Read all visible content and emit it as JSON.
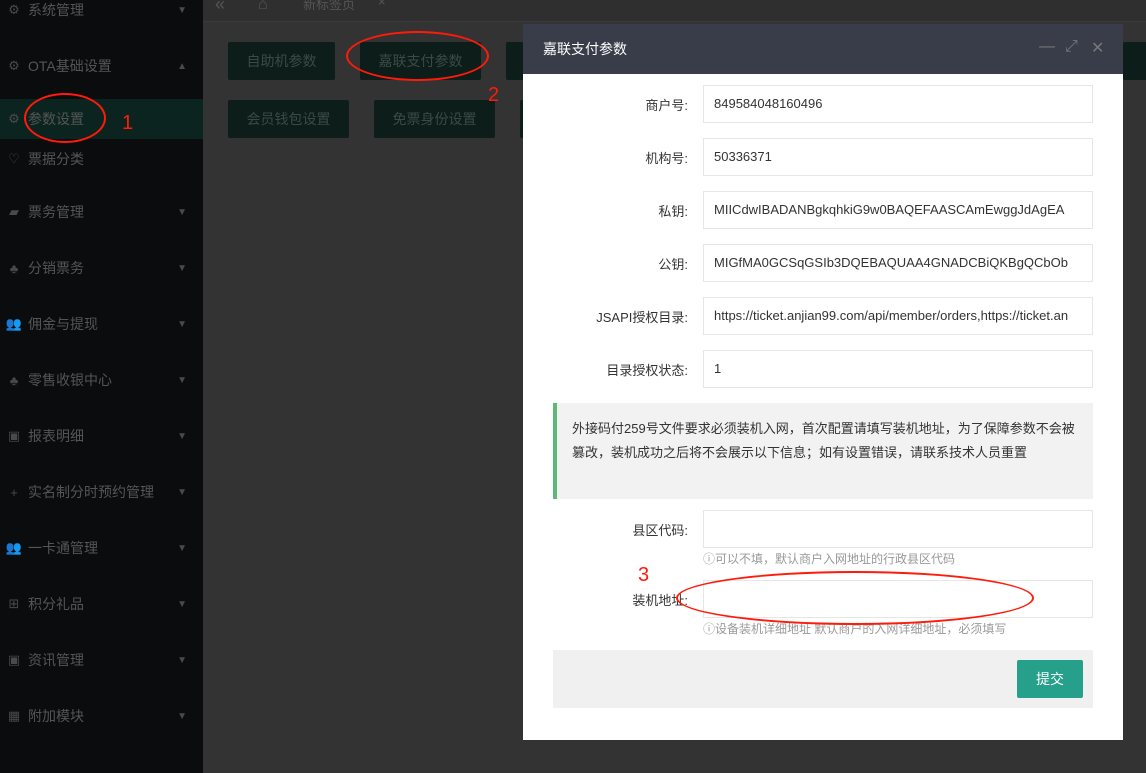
{
  "sidebar": {
    "items": [
      {
        "label": "系统管理",
        "icon": "gear-icon",
        "arrow": "▼"
      },
      {
        "label": "OTA基础设置",
        "icon": "gear-icon",
        "arrow": "▲"
      },
      {
        "label": "参数设置",
        "icon": "gear-icon",
        "arrow": ""
      },
      {
        "label": "票据分类",
        "icon": "heart-icon",
        "arrow": ""
      },
      {
        "label": "票务管理",
        "icon": "ticket-icon",
        "arrow": "▼"
      },
      {
        "label": "分销票务",
        "icon": "distribute-icon",
        "arrow": "▼"
      },
      {
        "label": "佣金与提现",
        "icon": "users-icon",
        "arrow": "▼"
      },
      {
        "label": "零售收银中心",
        "icon": "cashier-icon",
        "arrow": "▼"
      },
      {
        "label": "报表明细",
        "icon": "report-icon",
        "arrow": "▼"
      },
      {
        "label": "实名制分时预约管理",
        "icon": "plus-icon",
        "arrow": "▼"
      },
      {
        "label": "一卡通管理",
        "icon": "users-icon",
        "arrow": "▼"
      },
      {
        "label": "积分礼品",
        "icon": "gift-icon",
        "arrow": "▼"
      },
      {
        "label": "资讯管理",
        "icon": "news-icon",
        "arrow": "▼"
      },
      {
        "label": "附加模块",
        "icon": "module-icon",
        "arrow": "▼"
      }
    ]
  },
  "tabs": {
    "back": "«",
    "home": "⌂",
    "current": "新标签页",
    "close": "×"
  },
  "page_buttons": [
    "自助机参数",
    "嘉联支付参数",
    "会员钱包设置",
    "免票身份设置"
  ],
  "modal": {
    "title": "嘉联支付参数",
    "min": "—",
    "max": "⤢",
    "close": "✕",
    "fields": [
      {
        "label": "商户号:",
        "value": "849584048160496"
      },
      {
        "label": "机构号:",
        "value": "50336371"
      },
      {
        "label": "私钥:",
        "value": "MIICdwIBADANBgkqhkiG9w0BAQEFAASCAmEwggJdAgEA"
      },
      {
        "label": "公钥:",
        "value": "MIGfMA0GCSqGSIb3DQEBAQUAA4GNADCBiQKBgQCbOb"
      },
      {
        "label": "JSAPI授权目录:",
        "value": "https://ticket.anjian99.com/api/member/orders,https://ticket.an"
      },
      {
        "label": "目录授权状态:",
        "value": "1"
      }
    ],
    "notice": "外接码付259号文件要求必须装机入网，首次配置请填写装机地址，为了保障参数不会被篡改，装机成功之后将不会展示以下信息；如有设置错误，请联系技术人员重置",
    "county_label": "县区代码:",
    "county_value": "",
    "county_hint": "ⓘ可以不填，默认商户入网地址的行政县区代码",
    "address_label": "装机地址:",
    "address_value": "",
    "address_hint": "ⓘ设备装机详细地址 默认商户的入网详细地址，必须填写",
    "submit": "提交"
  },
  "annotations": [
    "1",
    "2",
    "3"
  ],
  "colors": {
    "accent": "#26a08b",
    "annotation": "#ff1a0a",
    "modal_header": "#393d49"
  }
}
